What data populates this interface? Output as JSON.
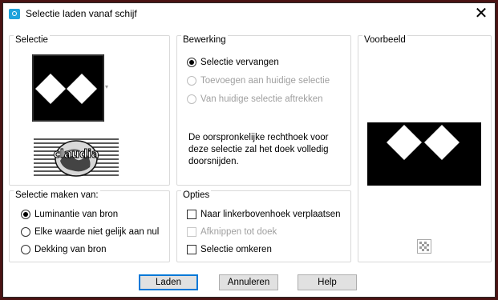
{
  "window": {
    "title": "Selectie laden vanaf schijf"
  },
  "selectie": {
    "title": "Selectie",
    "preview_logo_text": "claudia"
  },
  "bewerking": {
    "title": "Bewerking",
    "options": [
      {
        "label": "Selectie vervangen",
        "checked": true,
        "enabled": true
      },
      {
        "label": "Toevoegen aan huidige selectie",
        "checked": false,
        "enabled": false
      },
      {
        "label": "Van huidige selectie aftrekken",
        "checked": false,
        "enabled": false
      }
    ],
    "note": "De oorspronkelijke rechthoek voor deze selectie zal het doek volledig doorsnijden."
  },
  "voorbeeld": {
    "title": "Voorbeeld"
  },
  "maken": {
    "title": "Selectie maken van:",
    "options": [
      {
        "label": "Luminantie van bron",
        "checked": true
      },
      {
        "label": "Elke waarde niet gelijk aan nul",
        "checked": false
      },
      {
        "label": "Dekking van bron",
        "checked": false
      }
    ]
  },
  "opties": {
    "title": "Opties",
    "items": [
      {
        "label": "Naar linkerbovenhoek verplaatsen",
        "checked": false,
        "enabled": true
      },
      {
        "label": "Afknippen tot doek",
        "checked": false,
        "enabled": false
      },
      {
        "label": "Selectie omkeren",
        "checked": false,
        "enabled": true
      }
    ]
  },
  "buttons": {
    "load": "Laden",
    "cancel": "Annuleren",
    "help": "Help"
  },
  "icons": {
    "close": "close-icon",
    "app": "app-icon",
    "dropdown": "chevron-down-icon",
    "transparency": "checkerboard-icon"
  }
}
